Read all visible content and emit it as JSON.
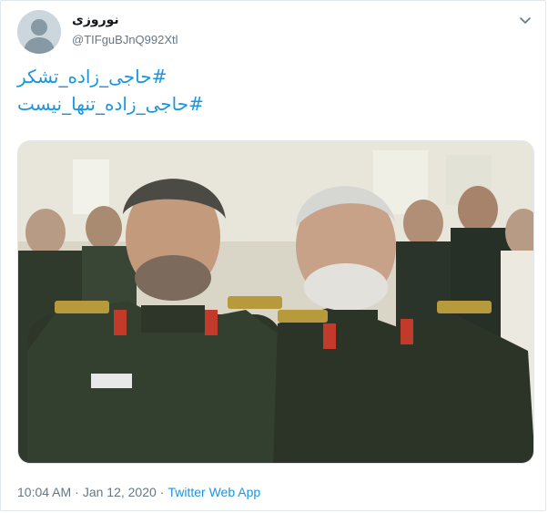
{
  "tweet": {
    "author": {
      "name": "نوروزی",
      "handle": "@TIFguBJnQ992Xtl"
    },
    "hashtags": [
      "#حاجی_زاده_تشکر",
      "#حاجی_زاده_تنها_نیست"
    ],
    "meta": {
      "time": "10:04 AM",
      "separator": "·",
      "date": "Jan 12, 2020",
      "source": "Twitter Web App"
    }
  },
  "icons": {
    "avatar": "default-avatar-icon",
    "caret": "chevron-down-icon"
  },
  "colors": {
    "link": "#1b95e0",
    "secondary_text": "#657786",
    "primary_text": "#14171a",
    "border": "#e1e8ed",
    "avatar_bg": "#ccd6dd"
  }
}
